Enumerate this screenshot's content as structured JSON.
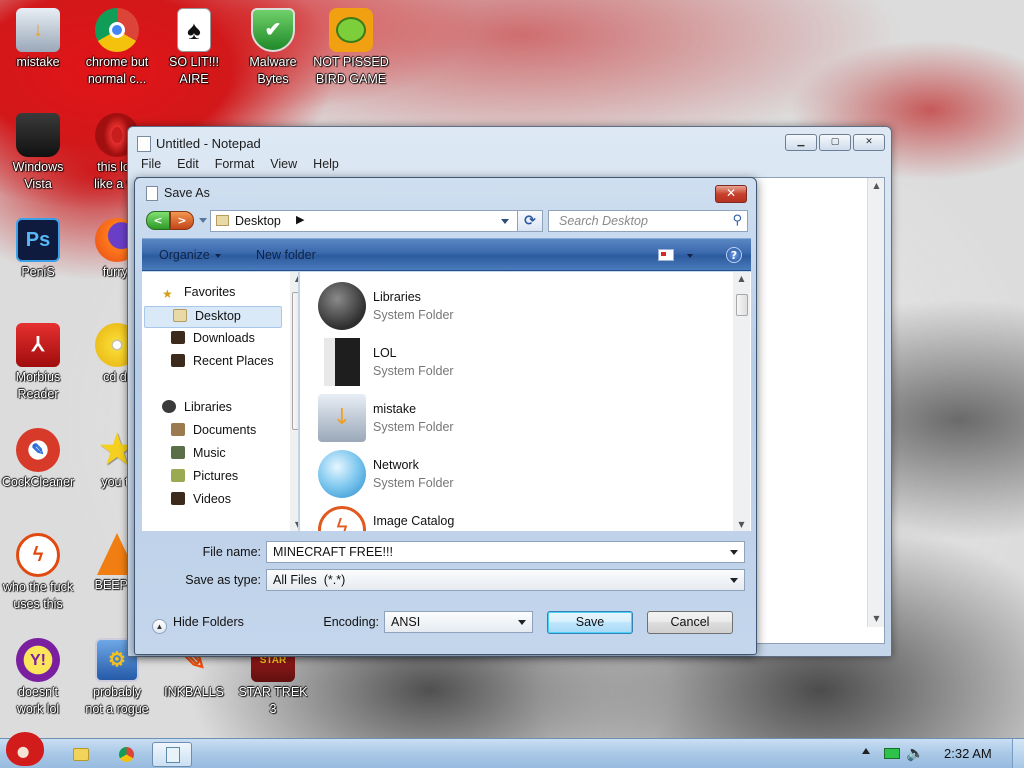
{
  "desktop": {
    "icons": [
      {
        "label1": "mistake",
        "label2": ""
      },
      {
        "label1": "chrome but",
        "label2": "normal c..."
      },
      {
        "label1": "SO LIT!!!",
        "label2": "AIRE"
      },
      {
        "label1": "Malware",
        "label2": "Bytes"
      },
      {
        "label1": "NOT PISSED",
        "label2": "BIRD GAME"
      },
      {
        "label1": "Windows",
        "label2": "Vista"
      },
      {
        "label1": "this loo",
        "label2": "like a va"
      },
      {
        "label1": "PeniS",
        "label2": ""
      },
      {
        "label1": "furryf",
        "label2": ""
      },
      {
        "label1": "Morbius",
        "label2": "Reader"
      },
      {
        "label1": "cd dr",
        "label2": ""
      },
      {
        "label1": "CockCleaner",
        "label2": ""
      },
      {
        "label1": "you tr",
        "label2": ""
      },
      {
        "label1": "who the fuck",
        "label2": "uses this"
      },
      {
        "label1": "BEEP B",
        "label2": ""
      },
      {
        "label1": "doesn't",
        "label2": "work lol"
      },
      {
        "label1": "probably",
        "label2": "not a rogue"
      },
      {
        "label1": "INKBALLS",
        "label2": ""
      },
      {
        "label1": "STAR TREK",
        "label2": "3"
      }
    ]
  },
  "notepad": {
    "title": "Untitled - Notepad",
    "menu": [
      "File",
      "Edit",
      "Format",
      "View",
      "Help"
    ]
  },
  "save_dialog": {
    "title": "Save As",
    "address_location": "Desktop",
    "search_placeholder": "Search Desktop",
    "toolbar": {
      "organize": "Organize",
      "new_folder": "New folder"
    },
    "nav_tree": {
      "favorites": "Favorites",
      "favorites_items": [
        "Desktop",
        "Downloads",
        "Recent Places"
      ],
      "libraries": "Libraries",
      "libraries_items": [
        "Documents",
        "Music",
        "Pictures",
        "Videos"
      ]
    },
    "files": [
      {
        "name": "Libraries",
        "type": "System Folder"
      },
      {
        "name": "LOL",
        "type": "System Folder"
      },
      {
        "name": "mistake",
        "type": "System Folder"
      },
      {
        "name": "Network",
        "type": "System Folder"
      },
      {
        "name": "Image Catalog",
        "type": ""
      }
    ],
    "file_name_label": "File name:",
    "file_name_value": "MINECRAFT FREE!!!",
    "save_type_label": "Save as type:",
    "save_type_value": "All Files  (*.*)",
    "hide_folders": "Hide Folders",
    "encoding_label": "Encoding:",
    "encoding_value": "ANSI",
    "save_button": "Save",
    "cancel_button": "Cancel"
  },
  "taskbar": {
    "clock": "2:32 AM"
  },
  "colors": {
    "toolbar_blue": "#3a69ad",
    "taskbar": "#a9c8e6",
    "desktop_red": "#d2181a"
  }
}
